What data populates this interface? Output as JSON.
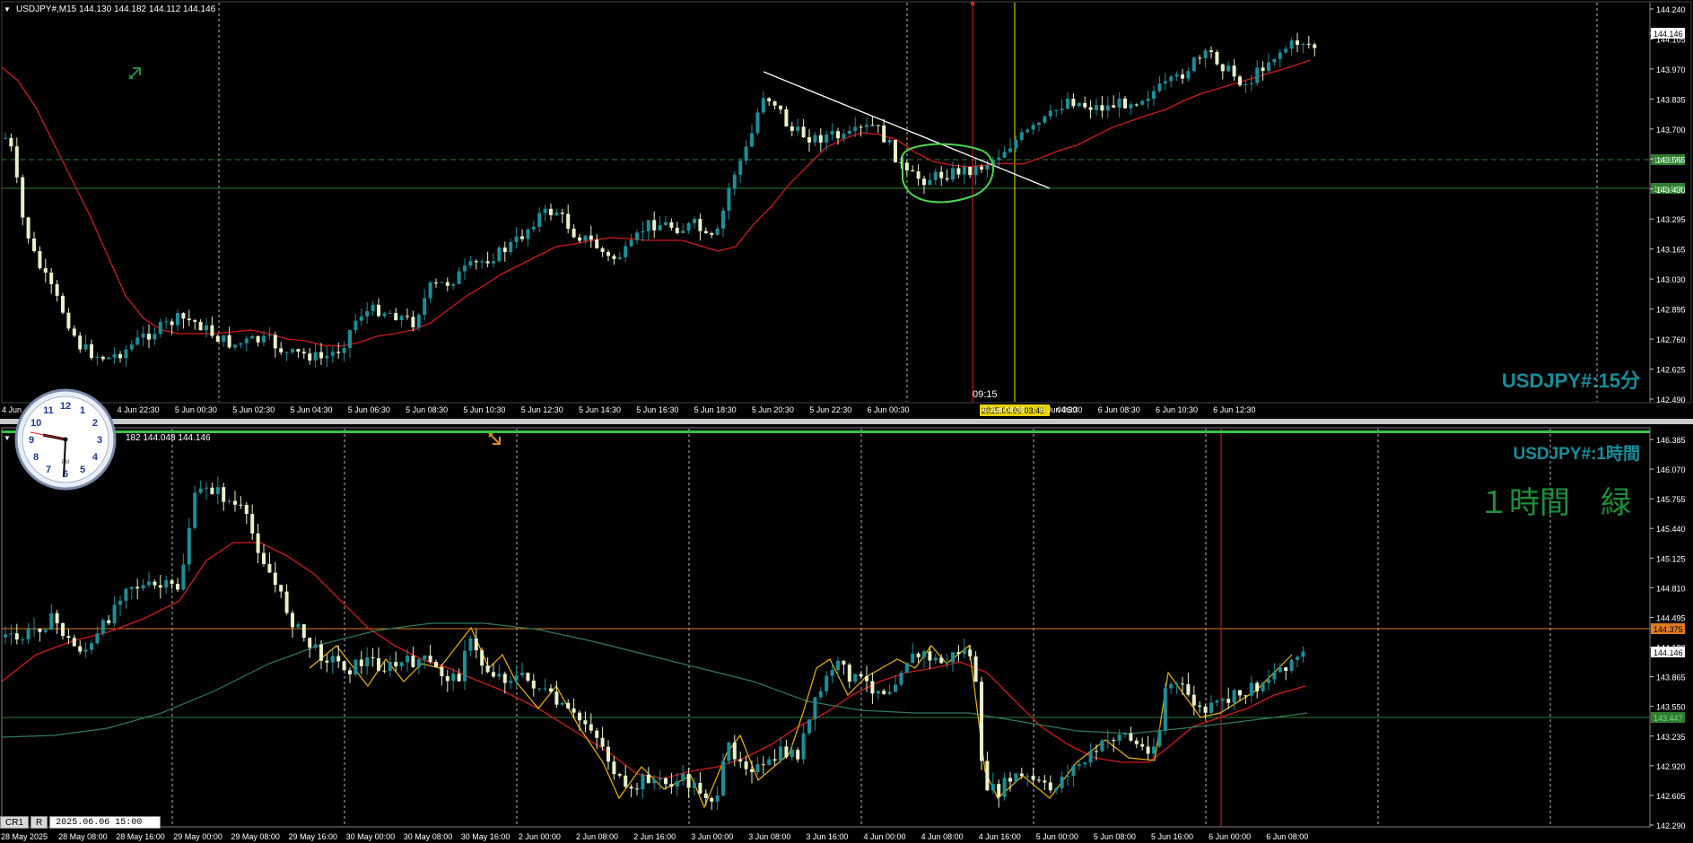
{
  "colors": {
    "background": "#000000",
    "candle_up": "#1a8f99",
    "candle_down": "#e6f2c8",
    "ma_red": "#d11a1a",
    "ma_green": "#2f7a5a",
    "zigzag": "#f0b400",
    "grid": "#ffffff",
    "hline_green": "#2e7d32",
    "hline_orange": "#e07a1f",
    "label_teal": "#138f9c",
    "label_green": "#1d8f3a",
    "vline_red": "#e02020",
    "vline_yellow": "#e6e600"
  },
  "top_chart": {
    "header": "USDJPY#,M15  144.130 144.182 144.112 144.146",
    "watermark": "USDJPY#:15分",
    "crosshair_time": "09:15",
    "crosshair_date": "2025.06.06 03:45",
    "current_price": "144.146",
    "line_prices": [
      "143.579",
      "143.447"
    ],
    "y_ticks": [
      "144.240",
      "144.105",
      "143.970",
      "143.835",
      "143.700",
      "143.565",
      "143.430",
      "143.295",
      "143.165",
      "143.030",
      "142.895",
      "142.760",
      "142.625",
      "142.490"
    ],
    "x_ticks": [
      "4 Jun",
      "4 Jun 20:30",
      "4 Jun 22:30",
      "5 Jun 00:30",
      "5 Jun 02:30",
      "5 Jun 04:30",
      "5 Jun 06:30",
      "5 Jun 08:30",
      "5 Jun 10:30",
      "5 Jun 12:30",
      "5 Jun 14:30",
      "5 Jun 16:30",
      "5 Jun 18:30",
      "5 Jun 20:30",
      "5 Jun 22:30",
      "6 Jun 00:30",
      "",
      "6 Jun 04:30",
      "6 Jun 06:30",
      "6 Jun 08:30",
      "6 Jun 10:30",
      "6 Jun 12:30"
    ],
    "x_ticks_partial": "04:30"
  },
  "bottom_chart": {
    "header": "182 144.048 144.146",
    "watermark": "USDJPY#:1時間",
    "note": "１時間　緑",
    "current_price": "144.146",
    "line_prices": [
      "144.375",
      "143.447"
    ],
    "y_ticks": [
      "146.385",
      "146.070",
      "145.755",
      "145.440",
      "145.125",
      "144.810",
      "144.495",
      "144.180",
      "143.865",
      "143.550",
      "143.235",
      "142.920",
      "142.605",
      "142.290"
    ],
    "x_ticks": [
      "28 May 2025",
      "28 May 08:00",
      "28 May 16:00",
      "29 May 00:00",
      "29 May 08:00",
      "29 May 16:00",
      "30 May 00:00",
      "30 May 08:00",
      "30 May 16:00",
      "2 Jun 00:00",
      "2 Jun 08:00",
      "2 Jun 16:00",
      "3 Jun 00:00",
      "3 Jun 08:00",
      "3 Jun 16:00",
      "4 Jun 00:00",
      "4 Jun 08:00",
      "4 Jun 16:00",
      "5 Jun 00:00",
      "5 Jun 08:00",
      "5 Jun 16:00",
      "6 Jun 00:00",
      "6 Jun 08:00"
    ]
  },
  "status_bar": {
    "btn1": "CR1",
    "btn2": "R",
    "time": "2025.06.06 15:00"
  },
  "clock": {
    "numbers": [
      "12",
      "1",
      "2",
      "3",
      "4",
      "5",
      "6",
      "7",
      "8",
      "9",
      "10",
      "11"
    ],
    "brand": "PM"
  }
}
